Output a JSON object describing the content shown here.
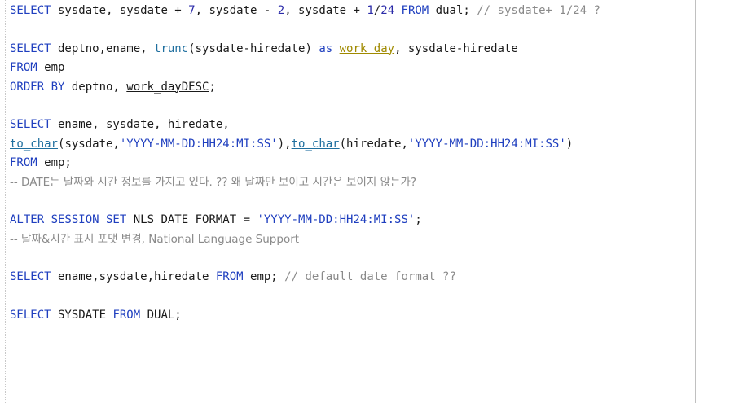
{
  "lines": [
    {
      "tokens": [
        {
          "t": "SELECT",
          "c": "kw"
        },
        {
          "t": " sysdate, sysdate + ",
          "c": "txt"
        },
        {
          "t": "7",
          "c": "num"
        },
        {
          "t": ", sysdate - ",
          "c": "txt"
        },
        {
          "t": "2",
          "c": "num"
        },
        {
          "t": ", sysdate + ",
          "c": "txt"
        },
        {
          "t": "1",
          "c": "num"
        },
        {
          "t": "/",
          "c": "txt"
        },
        {
          "t": "24",
          "c": "num"
        },
        {
          "t": " ",
          "c": "txt"
        },
        {
          "t": "FROM",
          "c": "kw"
        },
        {
          "t": " dual; ",
          "c": "txt"
        },
        {
          "t": "// sysdate+ 1/24 ?",
          "c": "cmt-mono"
        }
      ]
    },
    {
      "tokens": []
    },
    {
      "tokens": [
        {
          "t": "SELECT",
          "c": "kw"
        },
        {
          "t": " deptno,ename, ",
          "c": "txt"
        },
        {
          "t": "trunc",
          "c": "fn"
        },
        {
          "t": "(sysdate-hiredate) ",
          "c": "txt"
        },
        {
          "t": "as",
          "c": "kw"
        },
        {
          "t": " ",
          "c": "txt"
        },
        {
          "t": "work_day",
          "c": "alias und"
        },
        {
          "t": ", sysdate-hiredate",
          "c": "txt"
        }
      ]
    },
    {
      "tokens": [
        {
          "t": "FROM",
          "c": "kw"
        },
        {
          "t": " emp",
          "c": "txt"
        }
      ]
    },
    {
      "tokens": [
        {
          "t": "ORDER BY",
          "c": "kw"
        },
        {
          "t": " deptno, ",
          "c": "txt"
        },
        {
          "t": "work_dayDESC",
          "c": "txt und"
        },
        {
          "t": ";",
          "c": "txt"
        }
      ]
    },
    {
      "tokens": []
    },
    {
      "tokens": [
        {
          "t": "SELECT",
          "c": "kw"
        },
        {
          "t": " ename, sysdate, hiredate,",
          "c": "txt"
        }
      ]
    },
    {
      "tokens": [
        {
          "t": "to_char",
          "c": "fn und"
        },
        {
          "t": "(sysdate,",
          "c": "txt"
        },
        {
          "t": "'YYYY-MM-DD:HH24:MI:SS'",
          "c": "str"
        },
        {
          "t": "),",
          "c": "txt"
        },
        {
          "t": "to_char",
          "c": "fn und"
        },
        {
          "t": "(hiredate,",
          "c": "txt"
        },
        {
          "t": "'YYYY-MM-DD:HH24:MI:SS'",
          "c": "str"
        },
        {
          "t": ")",
          "c": "txt"
        }
      ]
    },
    {
      "tokens": [
        {
          "t": "FROM",
          "c": "kw"
        },
        {
          "t": " emp;",
          "c": "txt"
        }
      ]
    },
    {
      "tokens": [
        {
          "t": "-- DATE는 날짜와 시간 정보를 가지고 있다. ?? 왜 날짜만 보이고 시간은 보이지 않는가?",
          "c": "cmt"
        }
      ]
    },
    {
      "tokens": []
    },
    {
      "tokens": [
        {
          "t": "ALTER SESSION SET",
          "c": "kw"
        },
        {
          "t": " NLS_DATE_FORMAT = ",
          "c": "txt"
        },
        {
          "t": "'YYYY-MM-DD:HH24:MI:SS'",
          "c": "str"
        },
        {
          "t": ";",
          "c": "txt"
        }
      ]
    },
    {
      "tokens": [
        {
          "t": "-- 날짜&시간 표시 포맷 변경, National Language Support",
          "c": "cmt"
        }
      ]
    },
    {
      "tokens": []
    },
    {
      "tokens": [
        {
          "t": "SELECT",
          "c": "kw"
        },
        {
          "t": " ename,sysdate,hiredate ",
          "c": "txt"
        },
        {
          "t": "FROM",
          "c": "kw"
        },
        {
          "t": " emp; ",
          "c": "txt"
        },
        {
          "t": "// default date format ??",
          "c": "cmt-mono"
        }
      ]
    },
    {
      "tokens": []
    },
    {
      "tokens": [
        {
          "t": "SELECT",
          "c": "kw"
        },
        {
          "t": " SYSDATE ",
          "c": "txt"
        },
        {
          "t": "FROM",
          "c": "kw"
        },
        {
          "t": " DUAL;",
          "c": "txt"
        }
      ]
    }
  ],
  "colors": {
    "keyword": "#1f3fbf",
    "function": "#1f6f9f",
    "string": "#1f3fbf",
    "alias": "#a08a00",
    "comment": "#8a8a8a",
    "text": "#1a1a1a"
  }
}
